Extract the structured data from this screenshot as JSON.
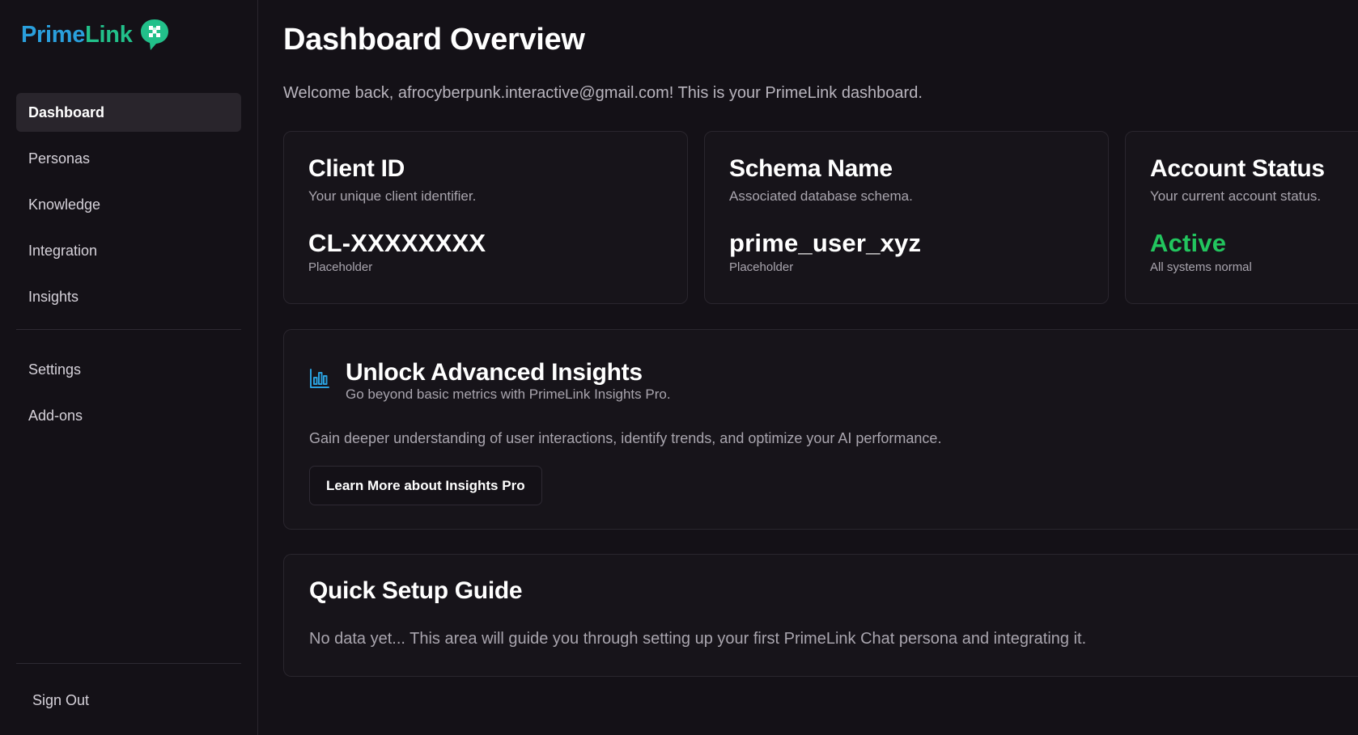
{
  "brand": {
    "name_part1": "Prime",
    "name_part2": "Link",
    "icon": "chat-bubble-logo-icon",
    "colors": {
      "prime": "#2a9fdc",
      "link": "#22c08a"
    }
  },
  "sidebar": {
    "items": [
      {
        "label": "Dashboard",
        "active": true
      },
      {
        "label": "Personas"
      },
      {
        "label": "Knowledge"
      },
      {
        "label": "Integration"
      },
      {
        "label": "Insights"
      }
    ],
    "secondary_items": [
      {
        "label": "Settings"
      },
      {
        "label": "Add-ons"
      }
    ],
    "sign_out": "Sign Out"
  },
  "main": {
    "title": "Dashboard Overview",
    "welcome": "Welcome back, afrocyberpunk.interactive@gmail.com! This is your PrimeLink dashboard.",
    "cards": [
      {
        "title": "Client ID",
        "description": "Your unique client identifier.",
        "value": "CL-XXXXXXXX",
        "note": "Placeholder"
      },
      {
        "title": "Schema Name",
        "description": "Associated database schema.",
        "value": "prime_user_xyz",
        "note": "Placeholder"
      },
      {
        "title": "Account Status",
        "description": "Your current account status.",
        "value": "Active",
        "note": "All systems normal",
        "value_color": "#22c55e"
      }
    ],
    "insights": {
      "icon": "bar-chart-icon",
      "title": "Unlock Advanced Insights",
      "subtitle": "Go beyond basic metrics with PrimeLink Insights Pro.",
      "body": "Gain deeper understanding of user interactions, identify trends, and optimize your AI performance.",
      "button": "Learn More about Insights Pro"
    },
    "guide": {
      "title": "Quick Setup Guide",
      "body": "No data yet... This area will guide you through setting up your first PrimeLink Chat persona and integrating it."
    }
  }
}
